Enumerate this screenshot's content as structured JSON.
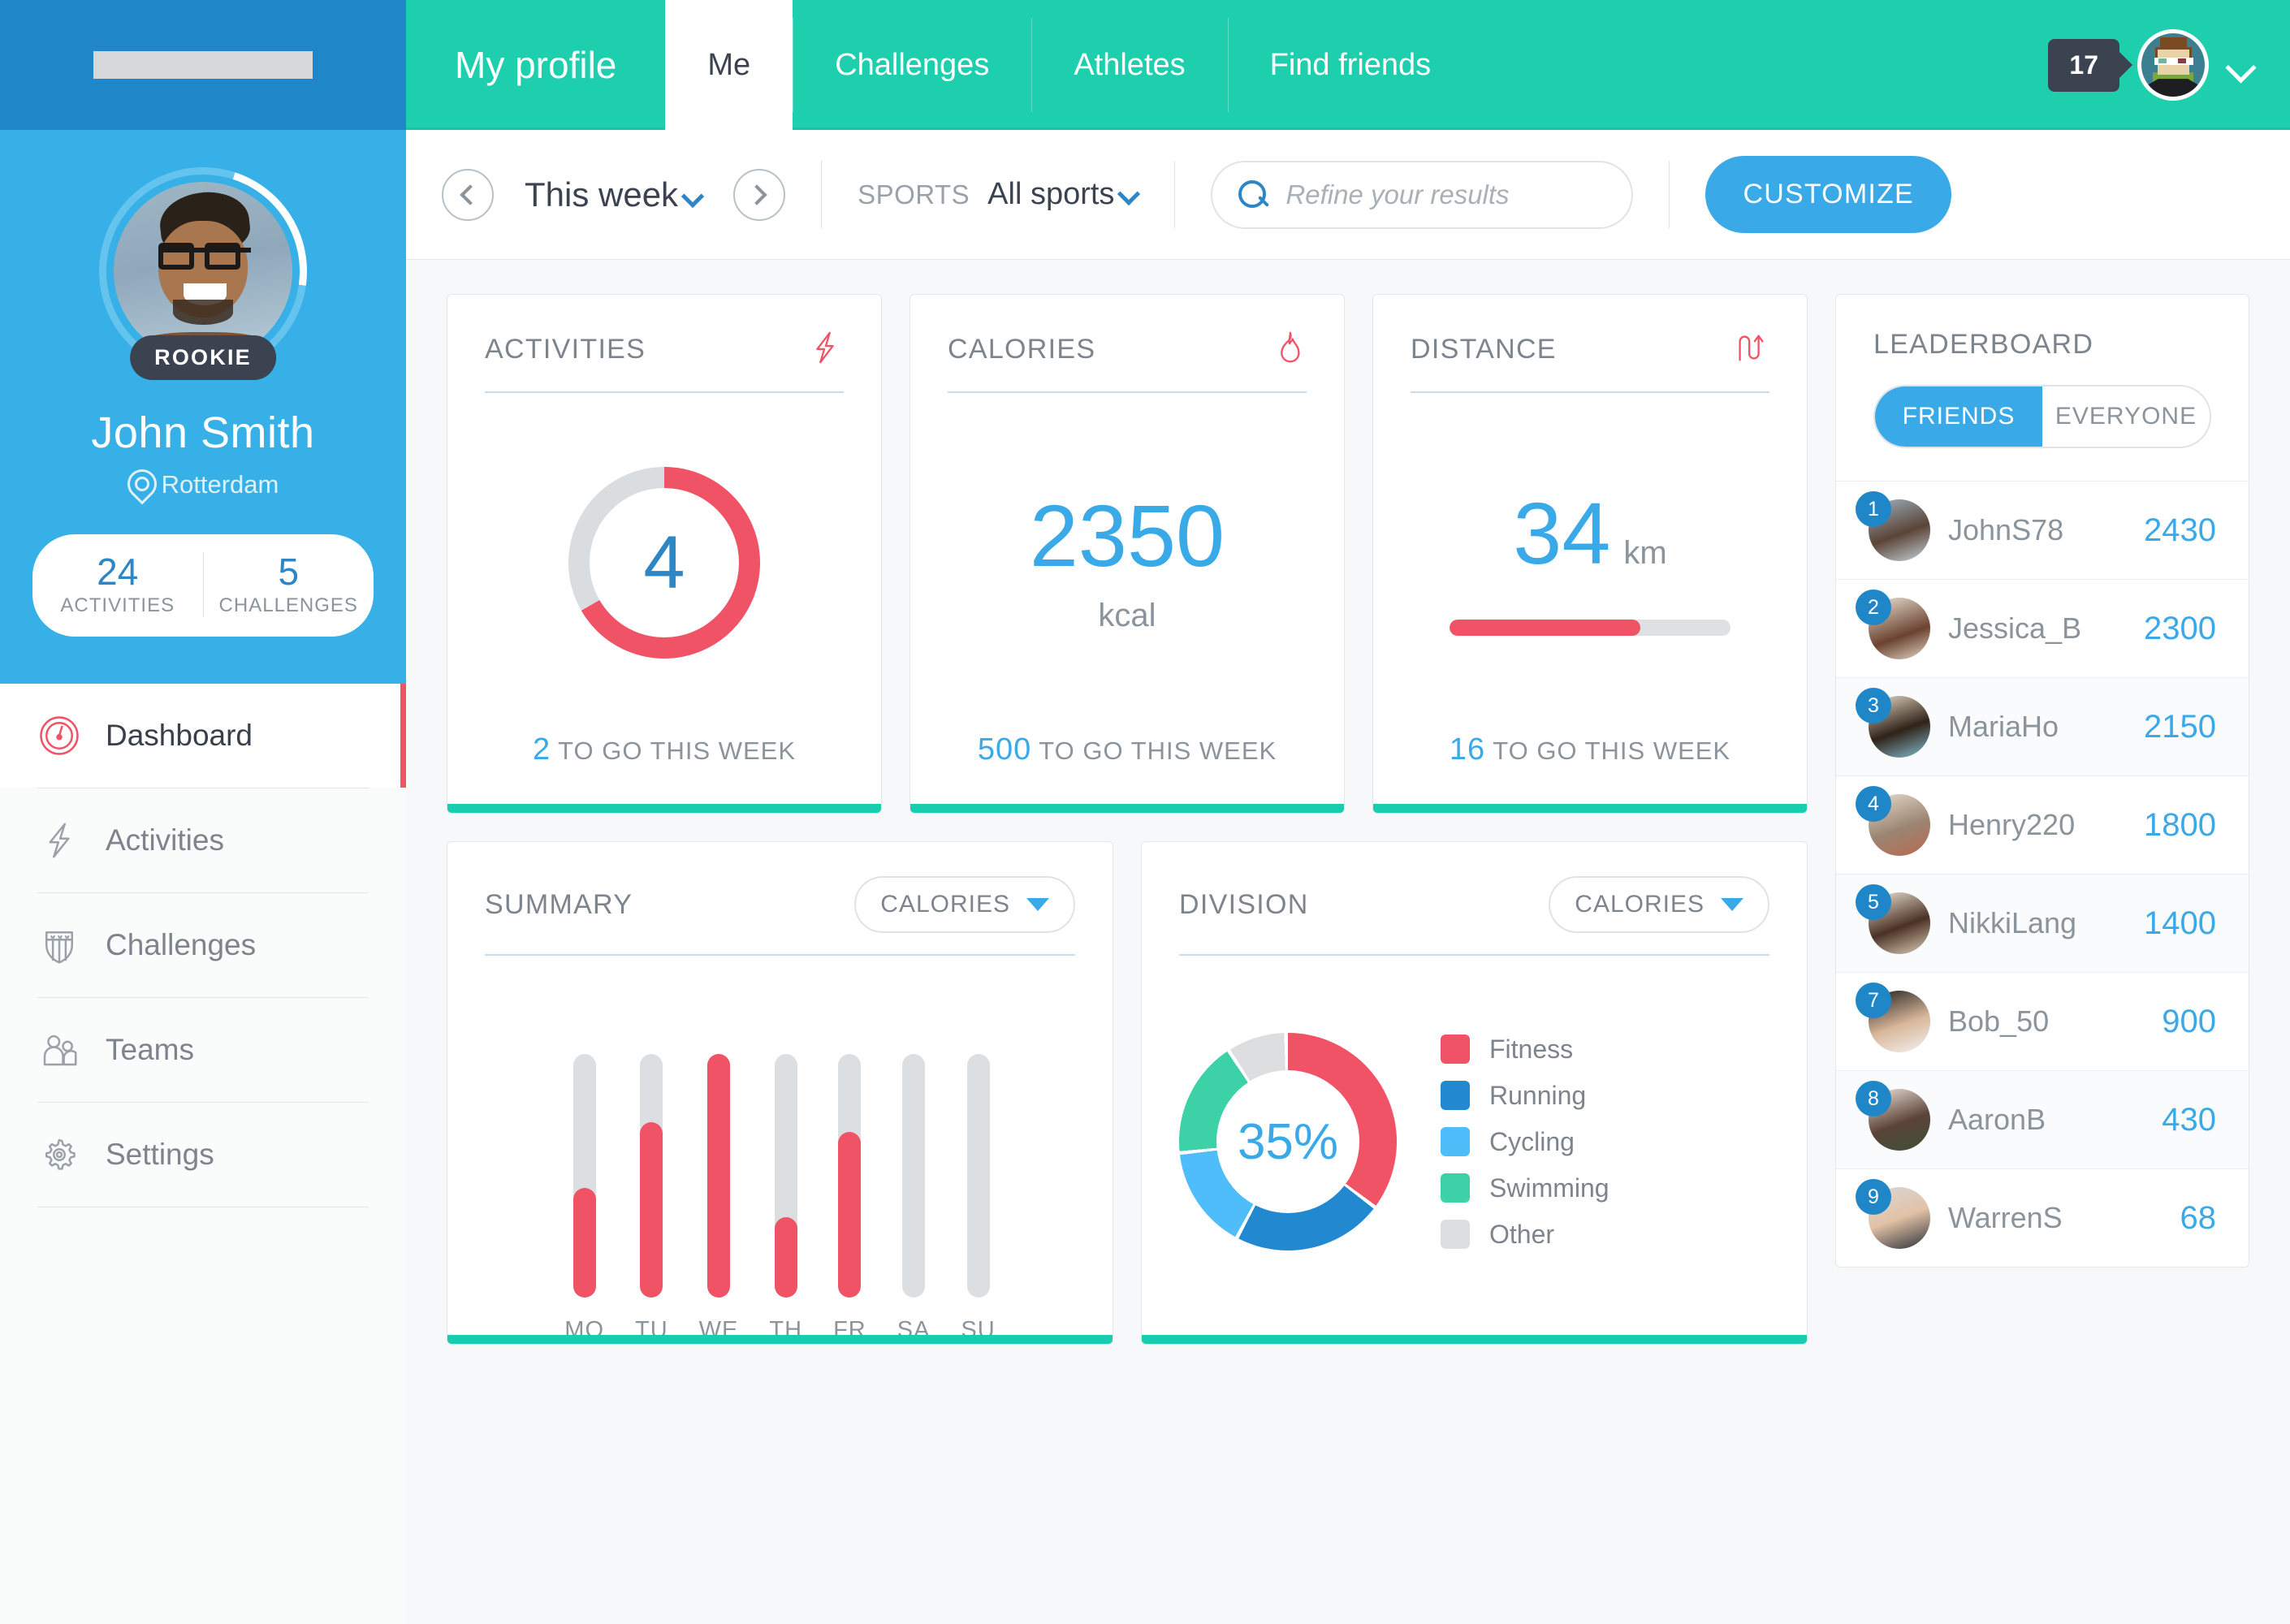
{
  "sidebar": {
    "logo_alt": "logo-placeholder",
    "profile": {
      "badge": "ROOKIE",
      "name": "John Smith",
      "location": "Rotterdam",
      "stats": [
        {
          "value": "24",
          "label": "ACTIVITIES"
        },
        {
          "value": "5",
          "label": "CHALLENGES"
        }
      ]
    },
    "nav": [
      {
        "label": "Dashboard",
        "icon": "gauge-icon",
        "active": true
      },
      {
        "label": "Activities",
        "icon": "lightning-icon",
        "active": false
      },
      {
        "label": "Challenges",
        "icon": "shield-icon",
        "active": false
      },
      {
        "label": "Teams",
        "icon": "people-icon",
        "active": false
      },
      {
        "label": "Settings",
        "icon": "gear-icon",
        "active": false
      }
    ]
  },
  "topnav": {
    "title": "My profile",
    "tabs": [
      {
        "label": "Me",
        "active": true
      },
      {
        "label": "Challenges",
        "active": false
      },
      {
        "label": "Athletes",
        "active": false
      },
      {
        "label": "Find friends",
        "active": false
      }
    ],
    "notification_count": "17",
    "avatar_alt": "user-avatar",
    "chevron": "chevron-down-icon"
  },
  "filterbar": {
    "prev_icon": "chevron-left-icon",
    "next_icon": "chevron-right-icon",
    "period": "This week",
    "sports_label": "SPORTS",
    "sports_value": "All sports",
    "search_placeholder": "Refine your results",
    "search_value": "",
    "customize_label": "CUSTOMIZE"
  },
  "stat_cards": [
    {
      "title": "ACTIVITIES",
      "icon": "lightning-icon",
      "type": "donut",
      "value": "4",
      "unit": "",
      "percent": 67,
      "footer_value": "2",
      "footer_text": "TO GO THIS WEEK"
    },
    {
      "title": "CALORIES",
      "icon": "flame-icon",
      "type": "number",
      "value": "2350",
      "unit": "kcal",
      "percent": 0,
      "footer_value": "500",
      "footer_text": "TO GO THIS WEEK"
    },
    {
      "title": "DISTANCE",
      "icon": "route-icon",
      "type": "bar",
      "value": "34",
      "unit": "km",
      "percent": 68,
      "footer_value": "16",
      "footer_text": "TO GO THIS WEEK"
    }
  ],
  "summary": {
    "title": "SUMMARY",
    "dropdown": "CALORIES"
  },
  "division": {
    "title": "DIVISION",
    "dropdown": "CALORIES",
    "center_value": "35%"
  },
  "leaderboard": {
    "title": "LEADERBOARD",
    "tabs": [
      {
        "label": "FRIENDS",
        "active": true
      },
      {
        "label": "EVERYONE",
        "active": false
      }
    ],
    "rows": [
      {
        "rank": "1",
        "name": "JohnS78",
        "score": "2430"
      },
      {
        "rank": "2",
        "name": "Jessica_B",
        "score": "2300"
      },
      {
        "rank": "3",
        "name": "MariaHo",
        "score": "2150"
      },
      {
        "rank": "4",
        "name": "Henry220",
        "score": "1800"
      },
      {
        "rank": "5",
        "name": "NikkiLang",
        "score": "1400"
      },
      {
        "rank": "7",
        "name": "Bob_50",
        "score": "900"
      },
      {
        "rank": "8",
        "name": "AaronB",
        "score": "430"
      },
      {
        "rank": "9",
        "name": "WarrenS",
        "score": "68"
      }
    ]
  },
  "colors": {
    "brand_green": "#1ECFAE",
    "accent_teal": "#18CDAF",
    "accent_blue": "#3AA9E8",
    "accent_red": "#EF5365",
    "sidebar_blue": "#36B0E6",
    "logo_blue": "#1F87C7",
    "track_gray": "#DCDFE2",
    "dark_slate": "#3C4350"
  },
  "chart_data": [
    {
      "type": "bar",
      "title": "SUMMARY",
      "metric": "CALORIES",
      "categories": [
        "MO",
        "TU",
        "WE",
        "TH",
        "FR",
        "SA",
        "SU"
      ],
      "values": [
        45,
        72,
        100,
        33,
        68,
        0,
        0
      ],
      "ylabel": "",
      "xlabel": "",
      "ylim": [
        0,
        100
      ],
      "grid": false,
      "legend": "none",
      "series_color": "#EF5365",
      "track_color": "#DCDFE2"
    },
    {
      "type": "pie",
      "title": "DIVISION",
      "metric": "CALORIES",
      "center_label": "35%",
      "labels": [
        "Fitness",
        "Running",
        "Cycling",
        "Swimming",
        "Other"
      ],
      "values": [
        35,
        22,
        15,
        17,
        11
      ],
      "colors": [
        "#EF5365",
        "#2288D0",
        "#4EBDFA",
        "#3DD1A8",
        "#DDDEE0"
      ],
      "legend": "right",
      "donut": true
    }
  ]
}
